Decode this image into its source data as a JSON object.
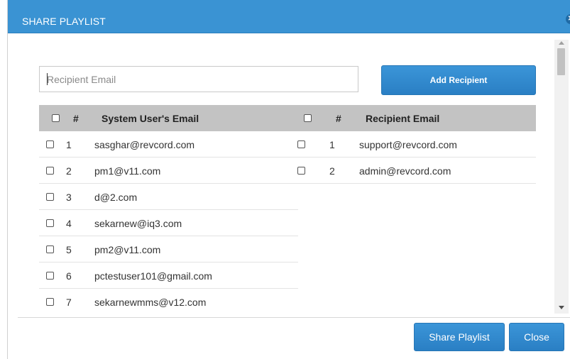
{
  "dialog": {
    "title": "SHARE PLAYLIST",
    "close_icon": "close-circle-icon"
  },
  "form": {
    "email_placeholder": "Recipient Email",
    "email_value": "",
    "add_button_label": "Add Recipient"
  },
  "system_users": {
    "headers": {
      "number": "#",
      "email": "System User's Email"
    },
    "rows": [
      {
        "number": "1",
        "email": "sasghar@revcord.com",
        "checked": false
      },
      {
        "number": "2",
        "email": "pm1@v11.com",
        "checked": false
      },
      {
        "number": "3",
        "email": "d@2.com",
        "checked": false
      },
      {
        "number": "4",
        "email": "sekarnew@iq3.com",
        "checked": false
      },
      {
        "number": "5",
        "email": "pm2@v11.com",
        "checked": false
      },
      {
        "number": "6",
        "email": "pctestuser101@gmail.com",
        "checked": false
      },
      {
        "number": "7",
        "email": "sekarnewmms@v12.com",
        "checked": false
      }
    ]
  },
  "recipients": {
    "headers": {
      "number": "#",
      "email": "Recipient Email"
    },
    "rows": [
      {
        "number": "1",
        "email": "support@revcord.com",
        "checked": false
      },
      {
        "number": "2",
        "email": "admin@revcord.com",
        "checked": false
      }
    ]
  },
  "footer": {
    "share_label": "Share Playlist",
    "close_label": "Close"
  },
  "colors": {
    "titlebar": "#3a93d3",
    "button": "#2a7fc4",
    "table_header": "#c3c3c3"
  }
}
